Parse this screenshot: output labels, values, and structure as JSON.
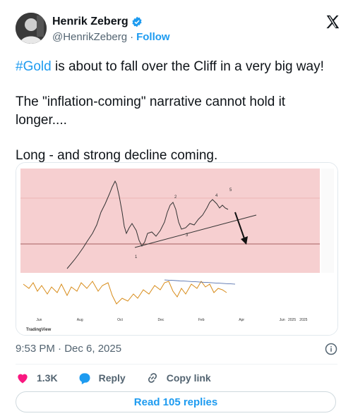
{
  "author": {
    "name": "Henrik Zeberg",
    "handle": "@HenrikZeberg",
    "follow_label": "Follow"
  },
  "tweet": {
    "hashtag": "#Gold",
    "line1_rest": " is about to fall over the Cliff in a very big way!",
    "paragraph2": "The \"inflation-coming\" narrative cannot hold it longer....",
    "paragraph3": "Long - and strong decline coming."
  },
  "chart": {
    "brand": "TradingView",
    "year_label": "2025",
    "wave_labels": [
      "1",
      "2",
      "3",
      "4",
      "5"
    ],
    "x_ticks": [
      "",
      "Jun",
      "",
      "",
      "",
      "Aug",
      "",
      "",
      "",
      "Oct",
      "",
      "",
      "",
      "Dec",
      "",
      "",
      "",
      "Feb",
      "",
      "",
      "",
      "Apr",
      "",
      "",
      "",
      "Jun",
      "",
      "2025",
      "",
      ""
    ]
  },
  "meta": {
    "timestamp": "9:53 PM · Dec 6, 2025"
  },
  "actions": {
    "likes": "1.3K",
    "reply_label": "Reply",
    "copy_label": "Copy link"
  },
  "read_replies_label": "Read 105 replies",
  "colors": {
    "accent": "#1d9bf0",
    "like": "#f91880",
    "chart_bg": "#f6cfd0",
    "osc_line": "#d88c1a"
  }
}
